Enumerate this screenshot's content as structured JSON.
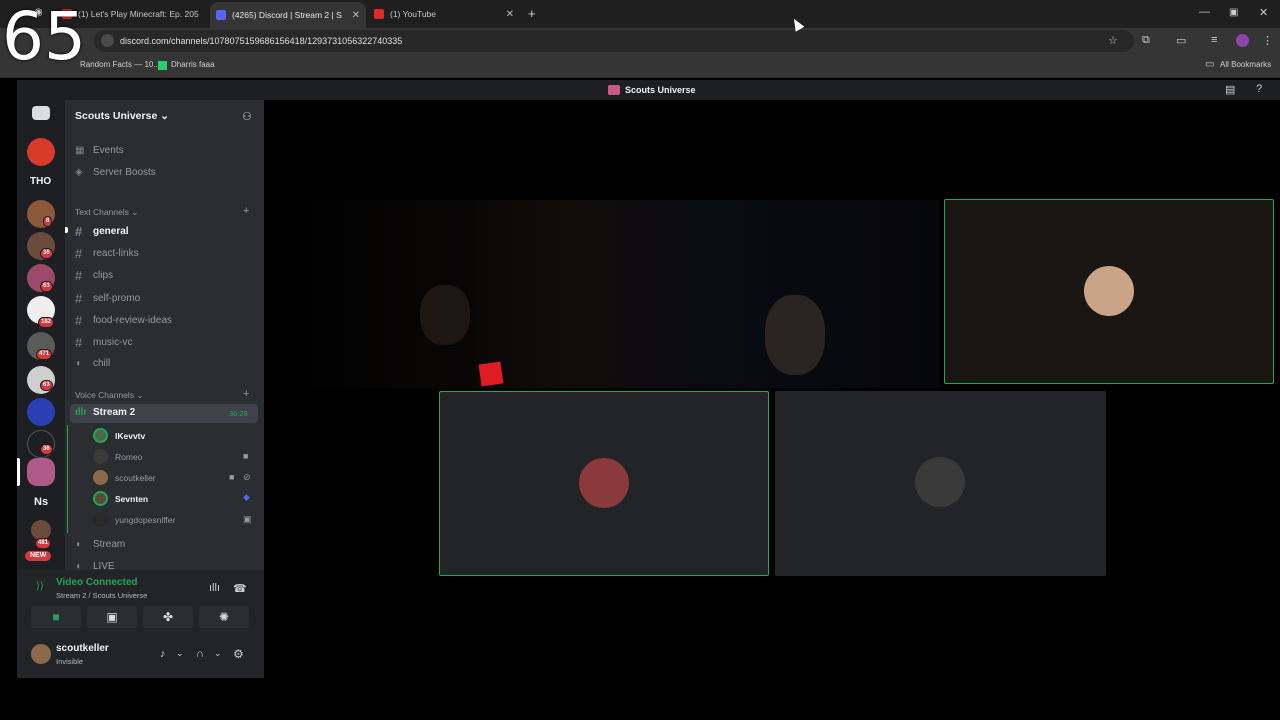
{
  "overlay_number": "65",
  "browser": {
    "tabs": [
      {
        "title": "(1) Let's Play Minecraft: Ep. 205"
      },
      {
        "title": "(4265) Discord | Stream 2 | S"
      },
      {
        "title": "(1) YouTube"
      }
    ],
    "url": "discord.com/channels/1078075159686156418/1293731056322740335",
    "bookmarks": [
      "Random Facts — 10...",
      "Dharris faaa"
    ],
    "all_bookmarks": "All Bookmarks"
  },
  "discord": {
    "window_title": "Scouts Universe",
    "server_name": "Scouts Universe",
    "server_rail": {
      "labels": [
        "THO",
        "Ns",
        "NEW"
      ],
      "badges": [
        "8",
        "36",
        "63",
        "182",
        "471",
        "63",
        "36",
        "481"
      ]
    },
    "nav": [
      {
        "label": "Events",
        "icon": "calendar-icon"
      },
      {
        "label": "Server Boosts",
        "icon": "boost-icon"
      }
    ],
    "text_category": "Text Channels",
    "text_channels": [
      "general",
      "react-links",
      "clips",
      "self-promo",
      "food-review-ideas",
      "music-vc",
      "chill"
    ],
    "voice_category": "Voice Channels",
    "active_voice": {
      "name": "Stream 2",
      "timer": "36:28"
    },
    "voice_users": [
      {
        "name": "lKevvtv",
        "bold": true
      },
      {
        "name": "Romeo",
        "bold": false
      },
      {
        "name": "scoutkeller",
        "bold": false
      },
      {
        "name": "Sevnten",
        "bold": true
      },
      {
        "name": "yungdopesniffer",
        "bold": false
      }
    ],
    "other_voice": [
      "Stream",
      "LIVE"
    ],
    "voice_panel": {
      "status": "Video Connected",
      "location": "Stream 2 / Scouts Universe"
    },
    "user": {
      "name": "scoutkeller",
      "status": "Invisible"
    }
  },
  "colors": {
    "accent_green": "#23a559",
    "tile_border": "#23a559",
    "badge_red": "#da373c"
  }
}
